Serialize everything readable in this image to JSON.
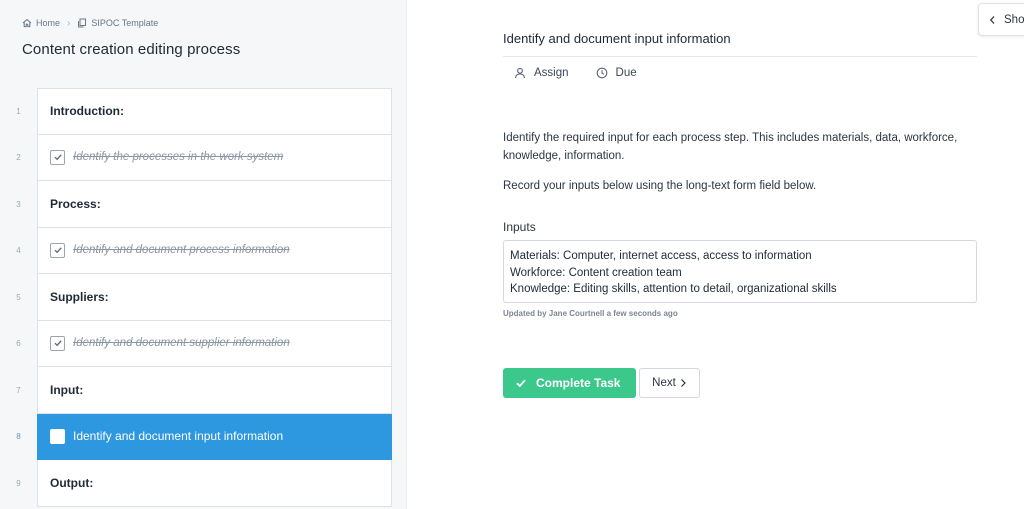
{
  "breadcrumb": {
    "home": "Home",
    "template": "SIPOC Template"
  },
  "checklist": {
    "title": "Content creation editing process",
    "tasks": [
      {
        "num": "1",
        "label": "Introduction:",
        "kind": "heading"
      },
      {
        "num": "2",
        "label": "Identify the processes in the work system",
        "kind": "done"
      },
      {
        "num": "3",
        "label": "Process:",
        "kind": "heading"
      },
      {
        "num": "4",
        "label": "Identify and document process information",
        "kind": "done"
      },
      {
        "num": "5",
        "label": "Suppliers:",
        "kind": "heading"
      },
      {
        "num": "6",
        "label": "Identify and document supplier information",
        "kind": "done"
      },
      {
        "num": "7",
        "label": "Input:",
        "kind": "heading"
      },
      {
        "num": "8",
        "label": "Identify and document input information",
        "kind": "active"
      },
      {
        "num": "9",
        "label": "Output:",
        "kind": "heading"
      }
    ]
  },
  "detail": {
    "title": "Identify and document input information",
    "assign_label": "Assign",
    "due_label": "Due",
    "description": "Identify the required input for each process step. This includes materials, data, workforce, knowledge, information.",
    "instruction": "Record your inputs below using the long-text form field below.",
    "field_label": "Inputs",
    "field_lines": [
      "Materials: Computer, internet access, access to information",
      "Workforce: Content creation team",
      "Knowledge: Editing skills, attention to detail, organizational skills"
    ],
    "updated_text": "Updated by Jane Courtnell a few seconds ago",
    "complete_label": "Complete Task",
    "next_label": "Next",
    "show_label": "Show"
  },
  "colors": {
    "active": "#2d97e0",
    "complete": "#3cc88b"
  }
}
